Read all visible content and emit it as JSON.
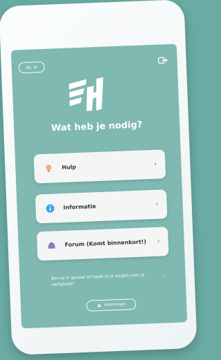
{
  "app": {
    "language_label": "NL",
    "heading": "Wat heb je nodig?"
  },
  "menu": {
    "items": [
      {
        "label": "Hulp",
        "icon": "lightbulb-icon"
      },
      {
        "label": "Informatie",
        "icon": "info-icon"
      },
      {
        "label": "Forum (Komt binnenkort!)",
        "icon": "chat-icon"
      }
    ]
  },
  "safety": {
    "text": "Ben je in gevaar of maak je je zorgen over je veiligheid?"
  },
  "settings": {
    "label": "Instellingen"
  },
  "colors": {
    "background": "#6aaba4",
    "screen": "#7fb9b1",
    "card": "#f3f6f5",
    "info_blue": "#39a6e8",
    "bulb_orange": "#f2b07d",
    "chat_purple": "#8e79b8"
  }
}
